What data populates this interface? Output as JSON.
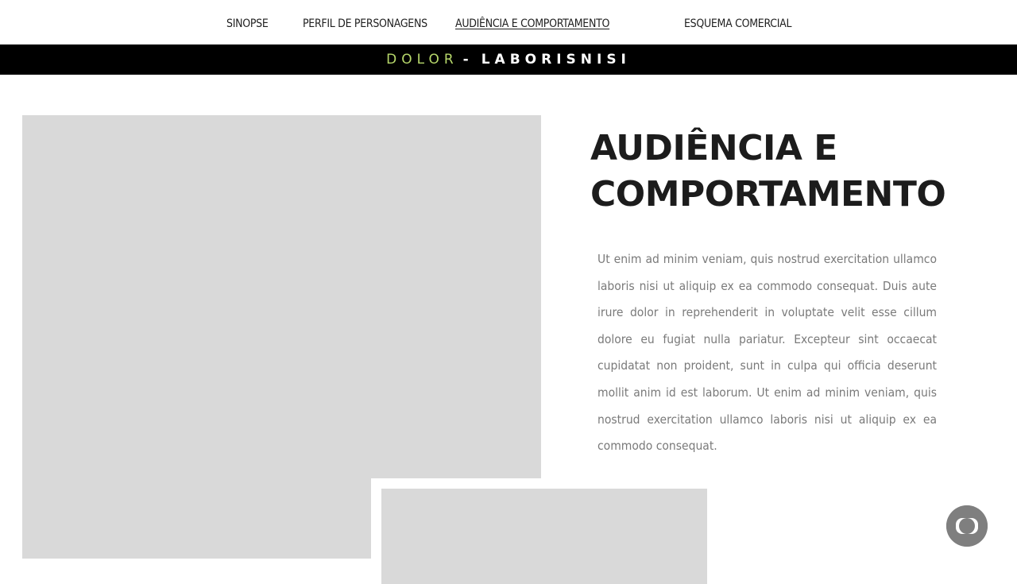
{
  "nav": {
    "items": [
      {
        "label": "SINOPSE"
      },
      {
        "label": "PERFIL DE PERSONAGENS"
      },
      {
        "label": "AUDIÊNCIA E COMPORTAMENTO"
      },
      {
        "label": "ESQUEMA COMERCIAL"
      }
    ],
    "active_index": 2
  },
  "banner": {
    "accent_text": "DOLOR",
    "separator": "-",
    "main_text": "LABORISNISI",
    "accent_color": "#b7d86b"
  },
  "section": {
    "title": "AUDIÊNCIA E\nCOMPORTAMENTO",
    "body": "Ut enim ad minim veniam, quis nostrud exercitation ullamco laboris nisi ut aliquip ex ea commodo consequat. Duis aute irure dolor in reprehenderit in voluptate velit esse cillum dolore eu fugiat nulla pariatur. Excepteur sint occaecat cupidatat non proident, sunt in culpa qui officia deserunt mollit anim id est laborum. Ut enim ad minim veniam, quis nostrud exercitation ullamco laboris nisi ut aliquip ex ea commodo consequat."
  },
  "media": {
    "placeholder_color": "#d9d9d9"
  },
  "fab": {
    "icon": "globo-logo-icon"
  }
}
